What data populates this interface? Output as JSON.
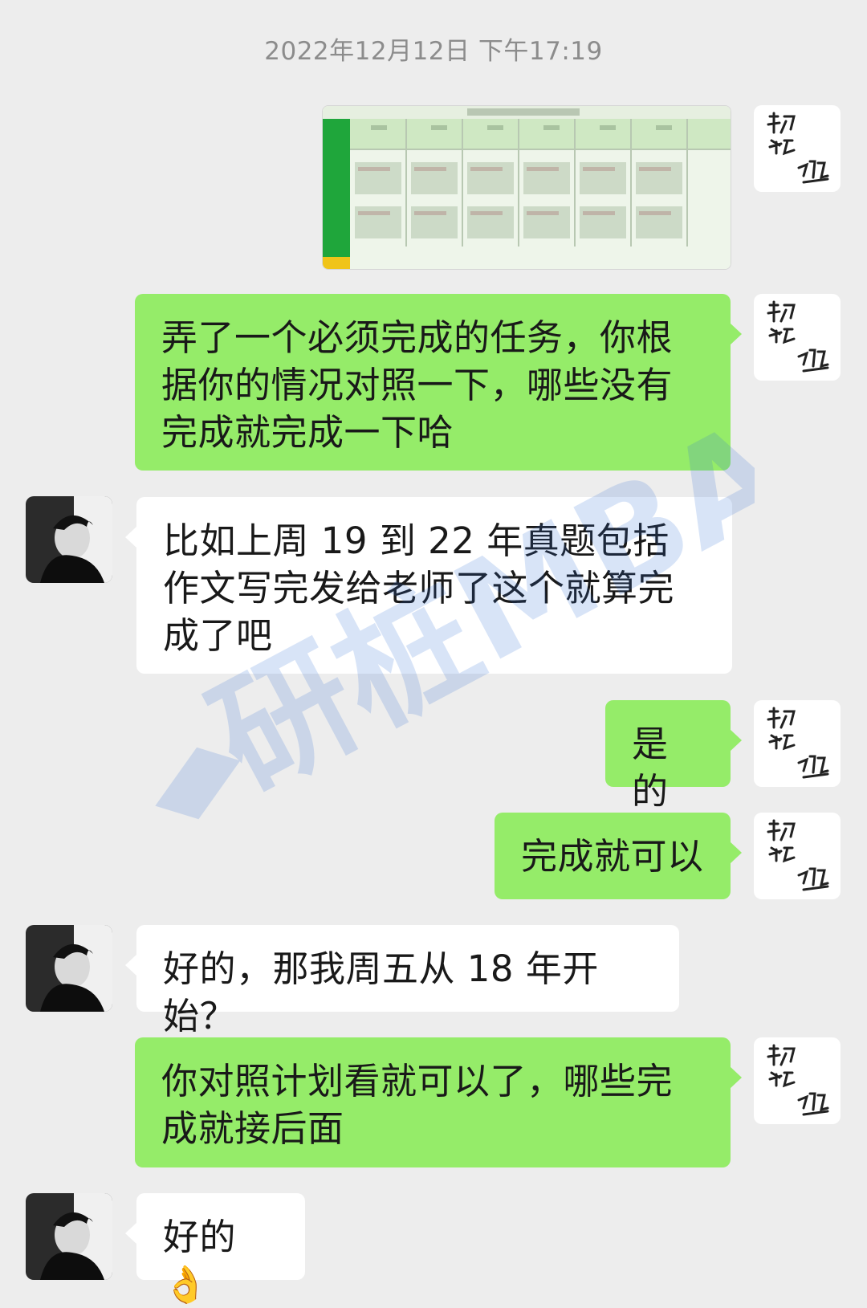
{
  "chat": {
    "timestamp": "2022年12月12日 下午17:19",
    "messages": [
      {
        "side": "right",
        "type": "image",
        "alt": ""
      },
      {
        "side": "right",
        "type": "text",
        "text": "弄了一个必须完成的任务，你根据你的情况对照一下，哪些没有完成就完成一下哈"
      },
      {
        "side": "left",
        "type": "text",
        "text": "比如上周 19 到 22 年真题包括作文写完发给老师了这个就算完成了吧"
      },
      {
        "side": "right",
        "type": "text",
        "text": "是的"
      },
      {
        "side": "right",
        "type": "text",
        "text": "完成就可以"
      },
      {
        "side": "left",
        "type": "text",
        "text": "好的，那我周五从 18 年开始？"
      },
      {
        "side": "right",
        "type": "text",
        "text": "你对照计划看就可以了，哪些完成就接后面"
      },
      {
        "side": "left",
        "type": "text",
        "text": "好的👌"
      }
    ]
  },
  "watermark": {
    "text": "研桩MBA"
  },
  "colors": {
    "background": "#ededed",
    "sent_bubble": "#95ec69",
    "received_bubble": "#ffffff",
    "timestamp": "#8c8c8c"
  },
  "icons": {
    "self_avatar": "calligraphy-avatar-icon",
    "contact_avatar": "person-photo-avatar-icon",
    "emoji": "ok-hand-emoji"
  }
}
